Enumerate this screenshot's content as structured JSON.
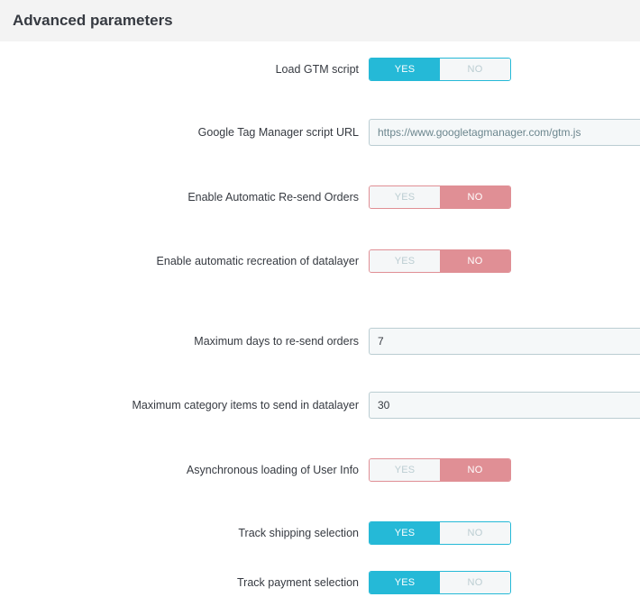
{
  "panel": {
    "title": "Advanced parameters"
  },
  "fields": [
    {
      "name": "load-gtm-script",
      "label": "Load GTM script",
      "type": "switch",
      "yes": "YES",
      "no": "NO",
      "value": "yes"
    },
    {
      "name": "gtm-script-url",
      "label": "Google Tag Manager script URL",
      "type": "text",
      "value": "https://www.googletagmanager.com/gtm.js"
    },
    {
      "name": "auto-resend-orders",
      "label": "Enable Automatic Re-send Orders",
      "type": "switch",
      "yes": "YES",
      "no": "NO",
      "value": "no"
    },
    {
      "name": "auto-recreate-datalayer",
      "label": "Enable automatic recreation of datalayer",
      "type": "switch",
      "yes": "YES",
      "no": "NO",
      "value": "no"
    },
    {
      "name": "max-days-resend",
      "label": "Maximum days to re-send orders",
      "type": "text",
      "value": "7"
    },
    {
      "name": "max-category-items",
      "label": "Maximum category items to send in datalayer",
      "type": "text",
      "value": "30"
    },
    {
      "name": "async-user-info",
      "label": "Asynchronous loading of User Info",
      "type": "switch",
      "yes": "YES",
      "no": "NO",
      "value": "no"
    },
    {
      "name": "track-shipping",
      "label": "Track shipping selection",
      "type": "switch",
      "yes": "YES",
      "no": "NO",
      "value": "yes"
    },
    {
      "name": "track-payment",
      "label": "Track payment selection",
      "type": "switch",
      "yes": "YES",
      "no": "NO",
      "value": "yes"
    }
  ],
  "colors": {
    "yes_active": "#25b9d7",
    "no_active": "#e08f95",
    "header_bg": "#f3f3f3"
  }
}
